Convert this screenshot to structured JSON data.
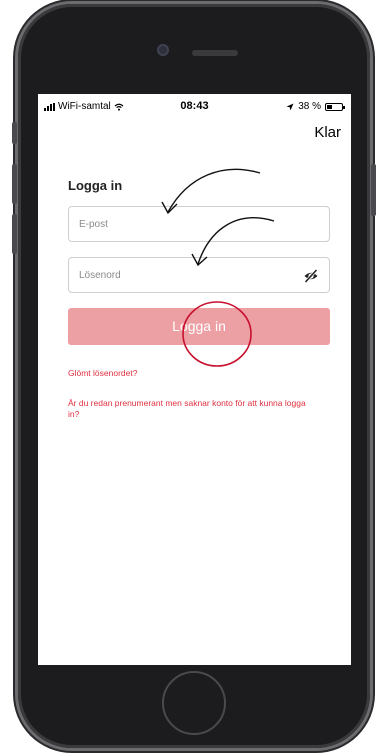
{
  "statusbar": {
    "carrier": "WiFi-samtal",
    "time": "08:43",
    "battery_text": "38 %",
    "battery_level": 0.38
  },
  "nav": {
    "done_label": "Klar"
  },
  "login": {
    "title": "Logga in",
    "email_placeholder": "E-post",
    "password_placeholder": "Lösenord",
    "submit_label": "Logga in",
    "forgot_link": "Glömt lösenordet?",
    "subscriber_link": "Är du redan prenumerant men saknar konto för att kunna logga in?"
  },
  "colors": {
    "accent": "#e03040",
    "button_bg": "#eda0a4",
    "annotation": "#c8102e"
  },
  "icons": [
    "wifi-icon",
    "location-arrow-icon",
    "battery-icon",
    "eye-off-icon"
  ]
}
